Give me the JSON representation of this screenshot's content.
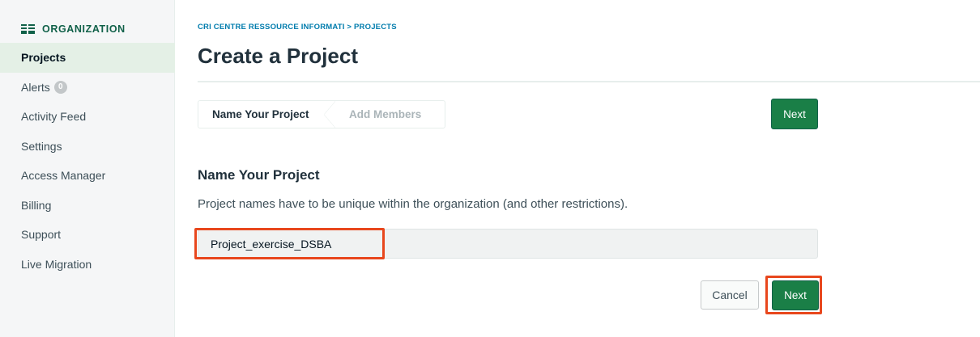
{
  "sidebar": {
    "org_label": "ORGANIZATION",
    "items": [
      {
        "label": "Projects"
      },
      {
        "label": "Alerts",
        "badge": "0"
      },
      {
        "label": "Activity Feed"
      },
      {
        "label": "Settings"
      },
      {
        "label": "Access Manager"
      },
      {
        "label": "Billing"
      },
      {
        "label": "Support"
      },
      {
        "label": "Live Migration"
      }
    ],
    "icon": "organization-icon"
  },
  "header": {
    "breadcrumb": "CRI CENTRE RESSOURCE INFORMATI > PROJECTS",
    "title": "Create a Project"
  },
  "wizard": {
    "steps": [
      "Name Your Project",
      "Add Members"
    ],
    "next_label": "Next"
  },
  "form": {
    "section_title": "Name Your Project",
    "description": "Project names have to be unique within the organization (and other restrictions).",
    "project_name_value": "Project_exercise_DSBA",
    "cancel_label": "Cancel",
    "next_label": "Next"
  },
  "colors": {
    "brand_green": "#116149",
    "button_green": "#1a7f47",
    "active_nav_bg": "#e4f0e6",
    "breadcrumb_blue": "#007cad",
    "highlight_red": "#e8471d"
  }
}
